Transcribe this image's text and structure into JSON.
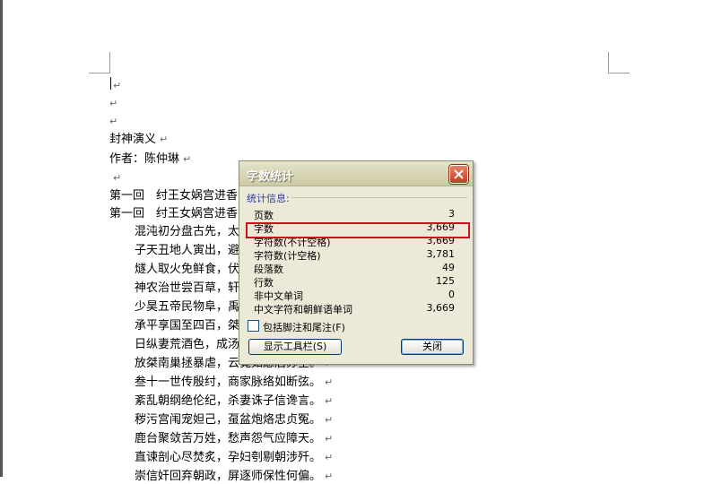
{
  "document": {
    "paragraph_mark": "↵",
    "lines": [
      {
        "text": "封神演义"
      },
      {
        "text": "作者：陈仲琳"
      },
      {
        "text": ""
      },
      {
        "text": "第一回　纣王女娲宫进香"
      },
      {
        "text": "第一回　纣王女娲宫进香"
      },
      {
        "text": "混沌初分盘古先，太极两仪四象悬。"
      },
      {
        "text": "子天丑地人寅出，避除兽患有巢贤。"
      },
      {
        "text": "燧人取火免鲜食，伏羲画卦阴阳前。"
      },
      {
        "text": "神农治世尝百草，轩辕礼乐婚姻联。"
      },
      {
        "text": "少昊五帝民物阜，禹王治水洪波蠲。"
      },
      {
        "text": "承平享国至四百，桀王无道乾坤颠。"
      },
      {
        "text": "日纵妻荒酒色，成汤造亳洗腥膻。"
      },
      {
        "text": "放桀南巢拯暴虐，云霓如愿后苏全。"
      },
      {
        "text": "叁十一世传殷纣，商家脉络如断弦。"
      },
      {
        "text": "紊乱朝纲绝伦纪，杀妻诛子信谗言。"
      },
      {
        "text": "秽污宫闱宠妲己，虿盆炮烙忠贞冤。"
      },
      {
        "text": "鹿台聚敛苦万姓，愁声怨气应障天。"
      },
      {
        "text": "直谏剖心尽焚炙，孕妇刳剔朝涉歼。"
      },
      {
        "text": "崇信奸回弃朝政，屏逐师保性何偏。"
      }
    ]
  },
  "dialog": {
    "title": "字数统计",
    "section_label": "统计信息:",
    "stats": [
      {
        "label": "页数",
        "value": "3"
      },
      {
        "label": "字数",
        "value": "3,669"
      },
      {
        "label": "字符数(不计空格)",
        "value": "3,669"
      },
      {
        "label": "字符数(计空格)",
        "value": "3,781"
      },
      {
        "label": "段落数",
        "value": "49"
      },
      {
        "label": "行数",
        "value": "125"
      },
      {
        "label": "非中文单词",
        "value": "0"
      },
      {
        "label": "中文字符和朝鲜语单词",
        "value": "3,669"
      }
    ],
    "checkbox_label": "包括脚注和尾注(F)",
    "checkbox_checked": false,
    "show_toolbar_button": "显示工具栏(S)",
    "close_button": "关闭"
  },
  "colors": {
    "highlight_box": "#c8141a",
    "dialog_bg": "#ece9d8",
    "section_text": "#2b3d9e"
  }
}
